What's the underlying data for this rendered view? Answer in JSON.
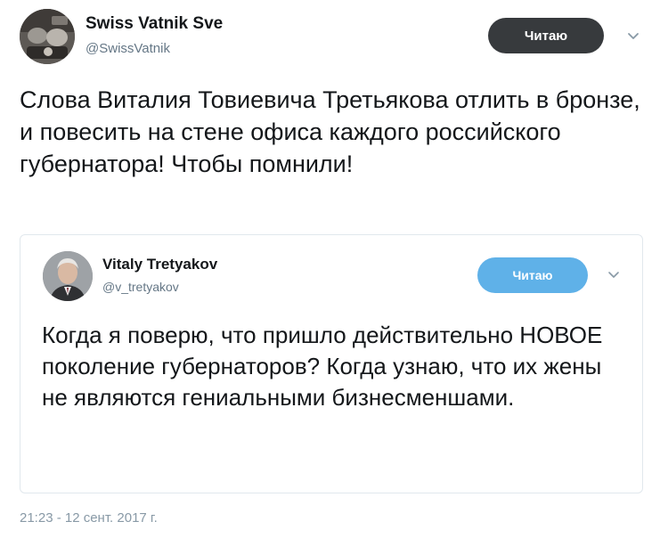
{
  "tweet": {
    "author": {
      "name": "Swiss Vatnik Sve",
      "handle": "@SwissVatnik"
    },
    "follow_label": "Читаю",
    "text": "Слова Виталия Товиевича Третьякова отлить в бронзе, и повесить на стене офиса каждого российского губернатора! Чтобы помнили!",
    "timestamp": "21:23 - 12 сент. 2017 г."
  },
  "quoted_tweet": {
    "author": {
      "name": "Vitaly Tretyakov",
      "handle": "@v_tretyakov"
    },
    "follow_label": "Читаю",
    "text": "Когда я поверю, что пришло действительно НОВОЕ поколение губернаторов? Когда узнаю, что их жены не являются гениальными бизнесменшами."
  },
  "icons": {
    "caret": "chevron-down-icon"
  },
  "colors": {
    "text_primary": "#14171a",
    "text_secondary": "#657786",
    "timestamp": "#8899a6",
    "follow_button_dark": "#373a3d",
    "follow_button_blue": "#5fb1e8",
    "card_border": "#e1e8ed"
  }
}
